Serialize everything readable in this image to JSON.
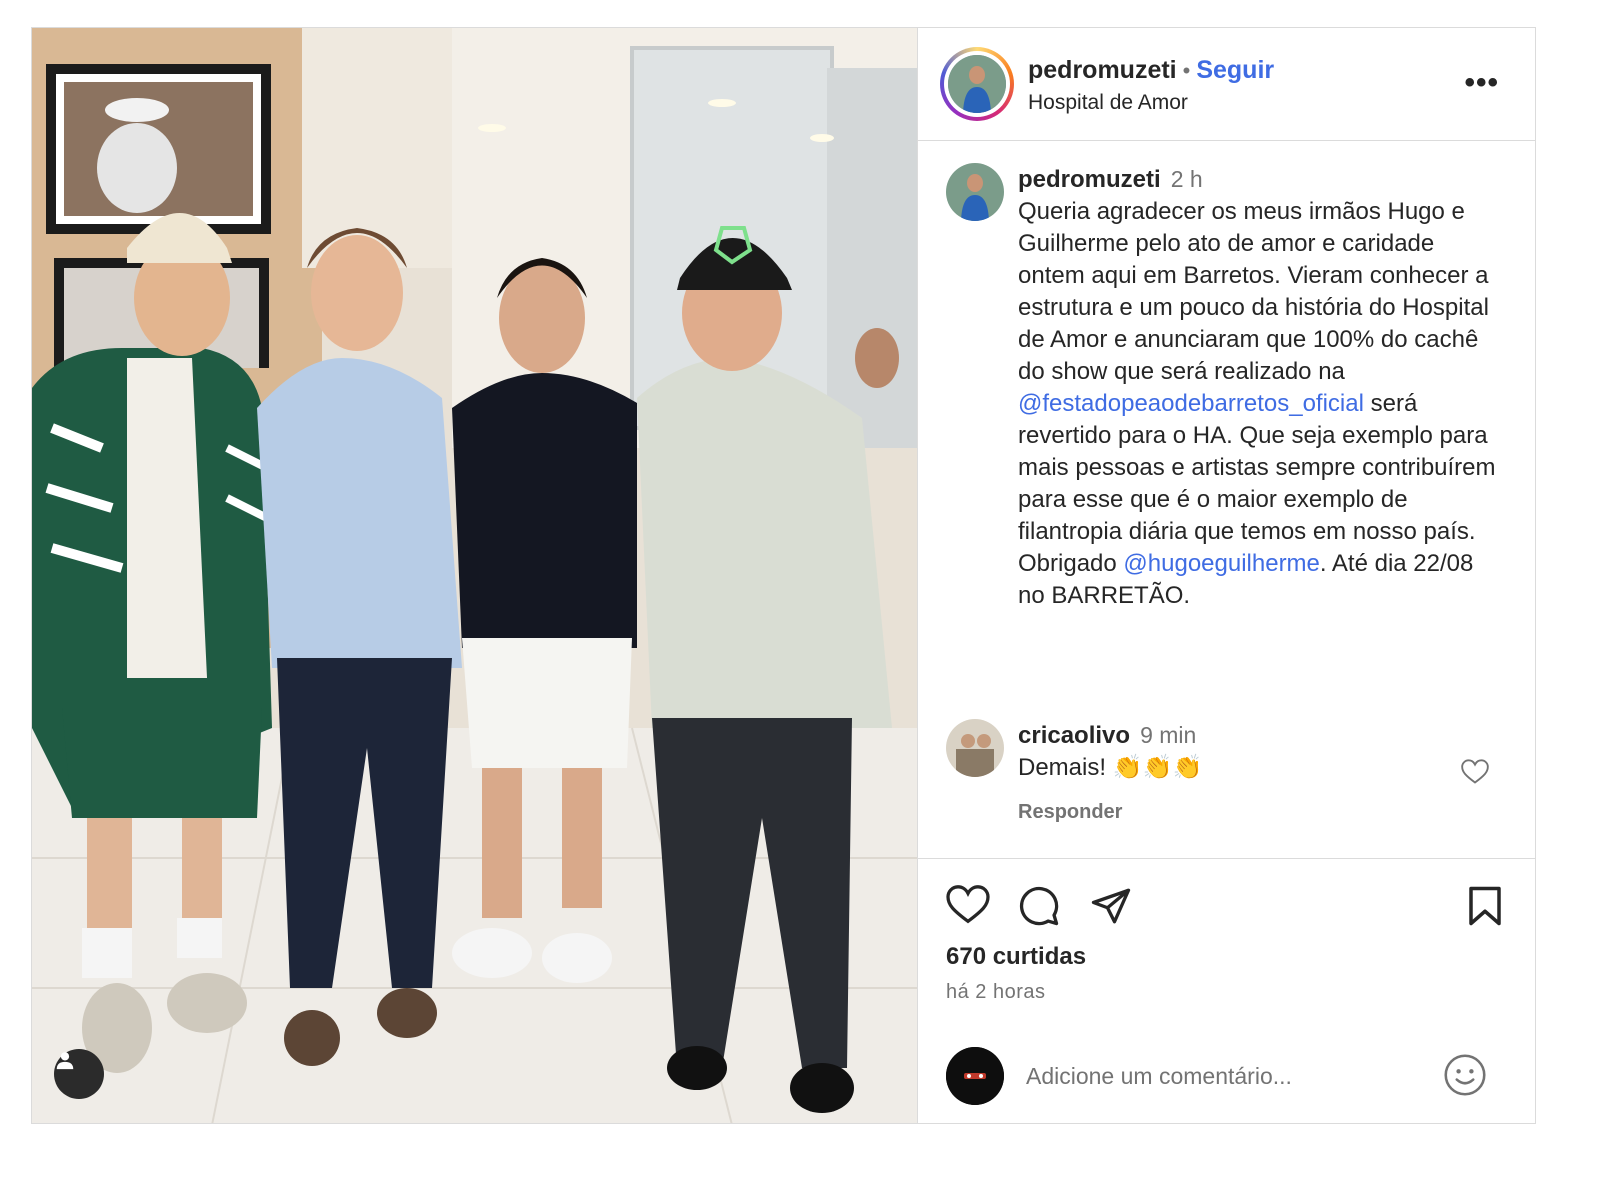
{
  "post": {
    "image_alt": "Four men posing together in a hospital lobby",
    "tag_icon": "person-tag-icon"
  },
  "header": {
    "username": "pedromuzeti",
    "separator": "•",
    "follow_label": "Seguir",
    "location": "Hospital de Amor",
    "more_label": "•••"
  },
  "caption": {
    "username": "pedromuzeti",
    "time": "2 h",
    "text_part1": "Queria agradecer os meus irmãos Hugo e Guilherme pelo ato de amor e caridade ontem aqui em Barretos. Vieram conhecer a estrutura e um pouco da história do Hospital de Amor e anunciaram que 100% do cachê do show que será realizado na ",
    "mention1": "@festadopeaodebarretos_oficial",
    "text_part2": " será revertido para o HA. Que seja exemplo para mais pessoas e artistas sempre contribuírem para esse que é o maior exemplo de filantropia diária que temos em nosso país. Obrigado ",
    "mention2": "@hugoeguilherme",
    "text_part3": ". Até dia 22/08 no BARRETÃO."
  },
  "comments": [
    {
      "username": "cricaolivo",
      "time": "9 min",
      "text": "Demais! 👏👏👏",
      "reply_label": "Responder"
    }
  ],
  "actions": {
    "likes": "670 curtidas",
    "time_ago": "há 2 horas"
  },
  "add_comment": {
    "placeholder": "Adicione um comentário..."
  },
  "colors": {
    "link": "#3f6ce3",
    "border": "#dbdbdb",
    "muted": "#737373",
    "text": "#262626"
  }
}
